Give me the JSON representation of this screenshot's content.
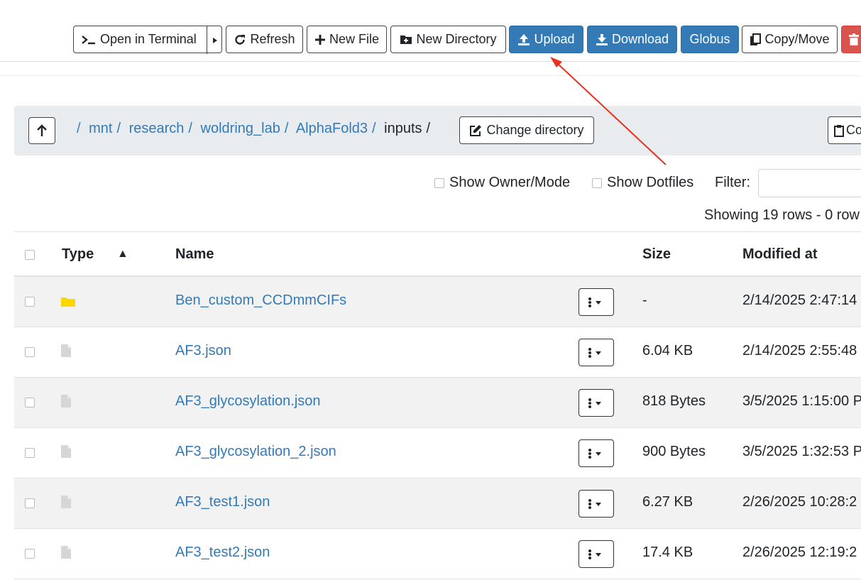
{
  "toolbar": {
    "open_terminal": "Open in Terminal",
    "refresh": "Refresh",
    "new_file": "New File",
    "new_directory": "New Directory",
    "upload": "Upload",
    "download": "Download",
    "globus": "Globus",
    "copy_move": "Copy/Move"
  },
  "breadcrumb": {
    "sep": "/",
    "parts": [
      "mnt",
      "research",
      "woldring_lab",
      "AlphaFold3"
    ],
    "current": "inputs",
    "change_directory": "Change directory",
    "copy_path_partial": "Co"
  },
  "options": {
    "show_owner_mode": "Show Owner/Mode",
    "show_dotfiles": "Show Dotfiles",
    "filter_label": "Filter:",
    "filter_value": ""
  },
  "status": {
    "showing": "Showing 19 rows - 0 row"
  },
  "table": {
    "headers": {
      "type": "Type",
      "sort_indicator": "▲",
      "name": "Name",
      "size": "Size",
      "modified": "Modified at"
    },
    "rows": [
      {
        "type": "folder",
        "name": "Ben_custom_CCDmmCIFs",
        "size": "-",
        "modified": "2/14/2025 2:47:14"
      },
      {
        "type": "file",
        "name": "AF3.json",
        "size": "6.04 KB",
        "modified": "2/14/2025 2:55:48"
      },
      {
        "type": "file",
        "name": "AF3_glycosylation.json",
        "size": "818 Bytes",
        "modified": "3/5/2025 1:15:00 P"
      },
      {
        "type": "file",
        "name": "AF3_glycosylation_2.json",
        "size": "900 Bytes",
        "modified": "3/5/2025 1:32:53 P"
      },
      {
        "type": "file",
        "name": "AF3_test1.json",
        "size": "6.27 KB",
        "modified": "2/26/2025 10:28:2"
      },
      {
        "type": "file",
        "name": "AF3_test2.json",
        "size": "17.4 KB",
        "modified": "2/26/2025 12:19:2"
      }
    ]
  },
  "colors": {
    "link": "#337ab7",
    "primary": "#337ab7",
    "danger": "#d9534f",
    "folder": "#ffd700",
    "annotation_arrow": "#e8321e"
  }
}
